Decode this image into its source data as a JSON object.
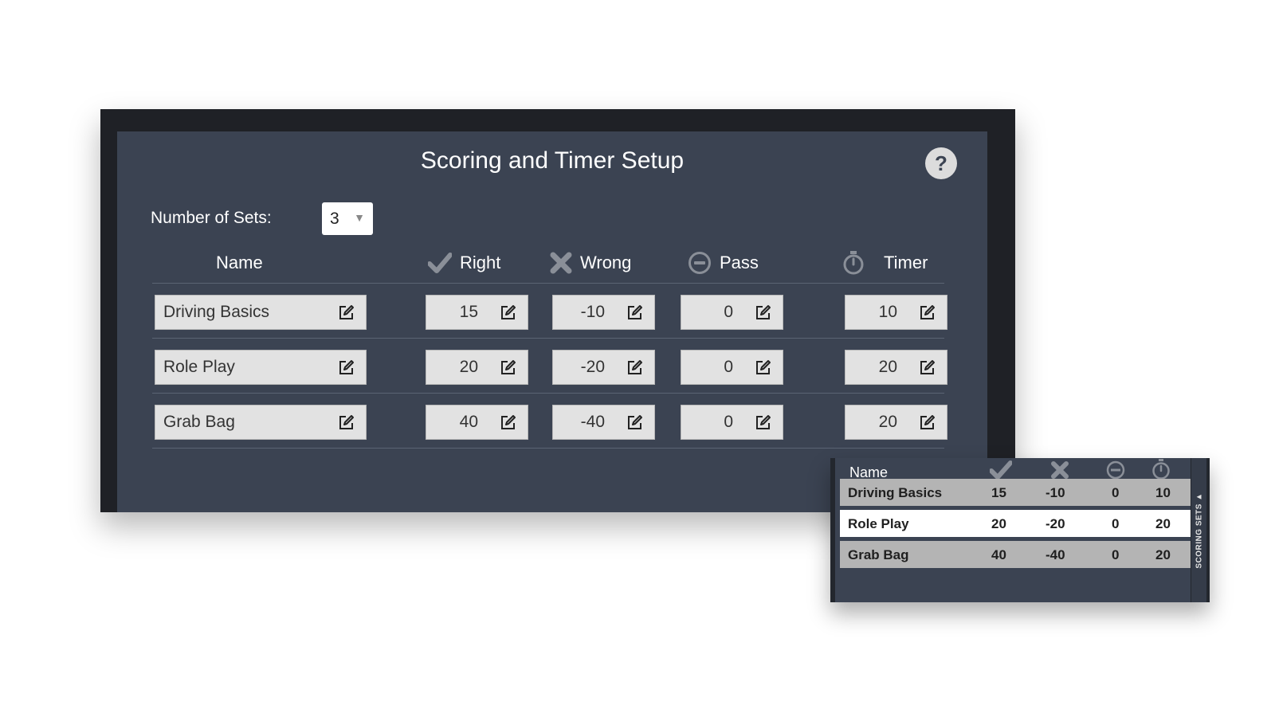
{
  "dialog": {
    "title": "Scoring and Timer Setup",
    "help_label": "?",
    "sets_label": "Number of Sets:",
    "sets_value": "3"
  },
  "columns": {
    "name": "Name",
    "right": "Right",
    "wrong": "Wrong",
    "pass": "Pass",
    "timer": "Timer"
  },
  "rows": [
    {
      "name": "Driving Basics",
      "right": "15",
      "wrong": "-10",
      "pass": "0",
      "timer": "10"
    },
    {
      "name": "Role Play",
      "right": "20",
      "wrong": "-20",
      "pass": "0",
      "timer": "20"
    },
    {
      "name": "Grab Bag",
      "right": "40",
      "wrong": "-40",
      "pass": "0",
      "timer": "20"
    }
  ],
  "mini_panel": {
    "header_name": "Name",
    "tab_label": "SCORING SETS ▲",
    "selected_row": 1
  },
  "icons": {
    "right": "checkmark-icon",
    "wrong": "x-icon",
    "pass": "minus-circle-icon",
    "timer": "stopwatch-icon",
    "edit": "edit-icon",
    "help": "help-icon",
    "dropdown": "triangle-down-icon"
  },
  "colors": {
    "panel_bg": "#3b4352",
    "frame_bg": "#1f2126",
    "cell_bg": "#e2e2e2",
    "icon_gray": "#8a8f98"
  }
}
